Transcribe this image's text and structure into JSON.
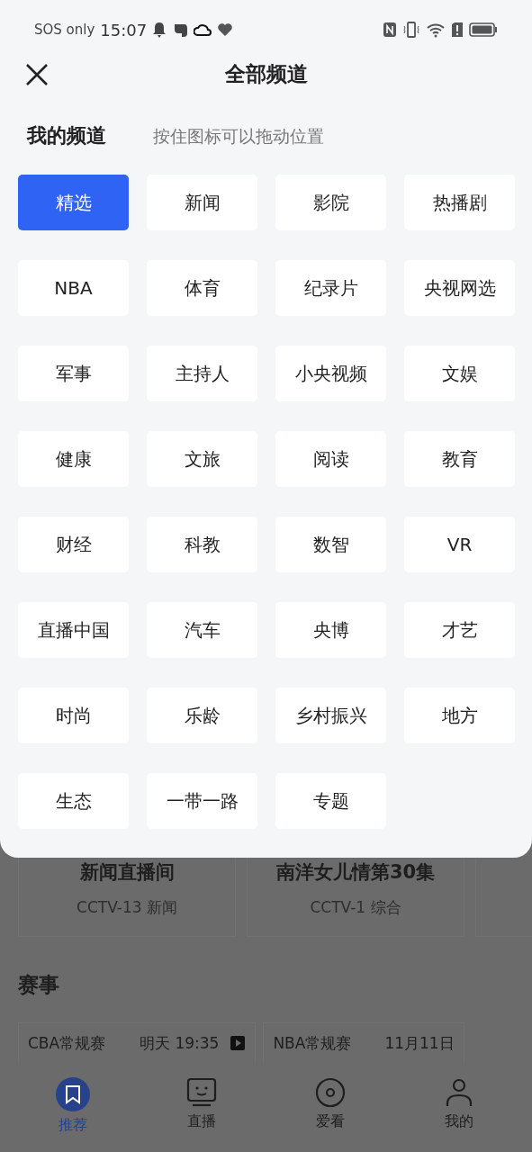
{
  "status_bar": {
    "carrier": "SOS only",
    "time": "15:07"
  },
  "header": {
    "title": "全部频道"
  },
  "my_channels": {
    "title": "我的频道",
    "hint": "按住图标可以拖动位置",
    "channels": [
      {
        "label": "精选",
        "selected": true
      },
      {
        "label": "新闻",
        "selected": false
      },
      {
        "label": "影院",
        "selected": false
      },
      {
        "label": "热播剧",
        "selected": false
      },
      {
        "label": "NBA",
        "selected": false
      },
      {
        "label": "体育",
        "selected": false
      },
      {
        "label": "纪录片",
        "selected": false
      },
      {
        "label": "央视网选",
        "selected": false
      },
      {
        "label": "军事",
        "selected": false
      },
      {
        "label": "主持人",
        "selected": false
      },
      {
        "label": "小央视频",
        "selected": false
      },
      {
        "label": "文娱",
        "selected": false
      },
      {
        "label": "健康",
        "selected": false
      },
      {
        "label": "文旅",
        "selected": false
      },
      {
        "label": "阅读",
        "selected": false
      },
      {
        "label": "教育",
        "selected": false
      },
      {
        "label": "财经",
        "selected": false
      },
      {
        "label": "科教",
        "selected": false
      },
      {
        "label": "数智",
        "selected": false
      },
      {
        "label": "VR",
        "selected": false
      },
      {
        "label": "直播中国",
        "selected": false
      },
      {
        "label": "汽车",
        "selected": false
      },
      {
        "label": "央博",
        "selected": false
      },
      {
        "label": "才艺",
        "selected": false
      },
      {
        "label": "时尚",
        "selected": false
      },
      {
        "label": "乐龄",
        "selected": false
      },
      {
        "label": "乡村振兴",
        "selected": false
      },
      {
        "label": "地方",
        "selected": false
      },
      {
        "label": "生态",
        "selected": false
      },
      {
        "label": "一带一路",
        "selected": false
      },
      {
        "label": "专题",
        "selected": false
      }
    ]
  },
  "live_cards": [
    {
      "title": "新闻直播间",
      "channel": "CCTV-13 新闻"
    },
    {
      "title": "南洋女儿情第30集",
      "channel": "CCTV-1 综合"
    }
  ],
  "events": {
    "title": "赛事",
    "items": [
      {
        "name": "CBA常规赛",
        "time": "明天 19:35"
      },
      {
        "name": "NBA常规赛",
        "time": "11月11日"
      }
    ]
  },
  "bottom_nav": [
    {
      "label": "推荐",
      "selected": true
    },
    {
      "label": "直播",
      "selected": false
    },
    {
      "label": "爱看",
      "selected": false
    },
    {
      "label": "我的",
      "selected": false
    }
  ]
}
